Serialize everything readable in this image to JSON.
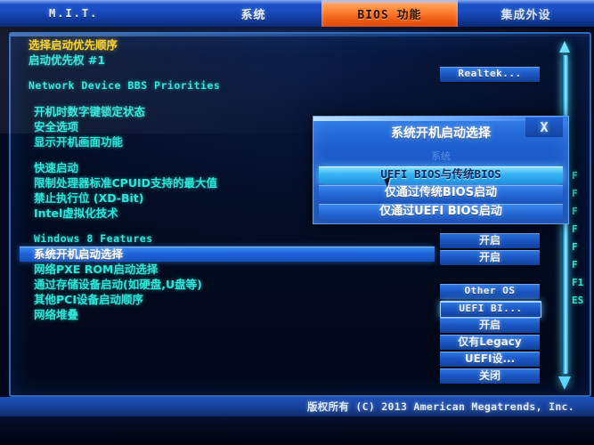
{
  "tabs": [
    {
      "label": "M.I.T.",
      "active": false
    },
    {
      "label": "系统",
      "active": false
    },
    {
      "label": "BIOS 功能",
      "active": true
    },
    {
      "label": "集成外设",
      "active": false
    }
  ],
  "settings": [
    {
      "label": "选择启动优先顺序",
      "style": "gold"
    },
    {
      "label": "启动优先权 #1",
      "style": "normal",
      "value": "Realtek..."
    },
    {
      "label": "Network Device BBS Priorities",
      "style": "mono"
    },
    {
      "label": "开机时数字键锁定状态",
      "style": "normal"
    },
    {
      "label": "安全选项",
      "style": "normal"
    },
    {
      "label": "显示开机画面功能",
      "style": "normal"
    },
    {
      "label": "快速启动",
      "style": "normal"
    },
    {
      "label": "限制处理器标准CPUID支持的最大值",
      "style": "normal",
      "value": "开启"
    },
    {
      "label": "禁止执行位 (XD-Bit)",
      "style": "normal",
      "value": "开启"
    },
    {
      "label": "Intel虚拟化技术",
      "style": "normal"
    },
    {
      "label": "Windows 8 Features",
      "style": "mono",
      "value": "Other OS"
    },
    {
      "label": "系统开机启动选择",
      "style": "selected",
      "value": "UEFI BI..."
    },
    {
      "label": "网络PXE ROM启动选择",
      "style": "normal",
      "value": "开启"
    },
    {
      "label": "通过存储设备启动(如硬盘,U盘等)",
      "style": "normal",
      "value": "仅有Legacy"
    },
    {
      "label": "其他PCI设备启动顺序",
      "style": "normal",
      "value": "UEFI设..."
    },
    {
      "label": "网络堆叠",
      "style": "normal",
      "value": "关闭"
    }
  ],
  "values": [
    {
      "text": "Realtek...",
      "mono": true,
      "focused": false
    },
    {
      "text": "开启",
      "mono": false,
      "focused": false
    },
    {
      "text": "开启",
      "mono": false,
      "focused": false
    },
    {
      "text": "Other OS",
      "mono": true,
      "focused": false
    },
    {
      "text": "UEFI BI...",
      "mono": true,
      "focused": true
    },
    {
      "text": "开启",
      "mono": false,
      "focused": false
    },
    {
      "text": "仅有Legacy",
      "mono": false,
      "focused": false
    },
    {
      "text": "UEFI设...",
      "mono": false,
      "focused": false
    },
    {
      "text": "关闭",
      "mono": false,
      "focused": false
    }
  ],
  "dialog": {
    "title": "系统开机启动选择",
    "subtitle": "系统",
    "close_label": "X",
    "options": [
      {
        "label": "UEFI BIOS与传统BIOS",
        "highlighted": true
      },
      {
        "label": "仅通过传统BIOS启动",
        "highlighted": false
      },
      {
        "label": "仅通过UEFI BIOS启动",
        "highlighted": false
      }
    ]
  },
  "help_keys": [
    "F",
    "F",
    "F",
    "F",
    "F",
    "F",
    "F1",
    "ES"
  ],
  "footer": {
    "copyright": "版权所有 (C) 2013 American Megatrends, Inc."
  },
  "scrollbar": {
    "up_arrow": "scroll-up-arrow",
    "down_arrow": "scroll-down-arrow"
  },
  "colors": {
    "accent_orange": "#f05a14",
    "cyan_text": "#2fe6d8",
    "gold_text": "#f5d328",
    "panel_blue": "#1b50c8",
    "highlight": "#39b6f5"
  }
}
